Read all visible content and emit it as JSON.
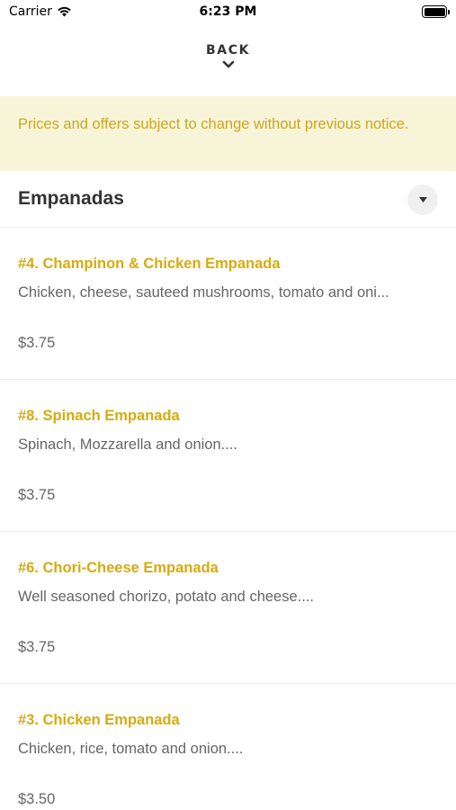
{
  "status_bar": {
    "carrier": "Carrier",
    "time": "6:23 PM",
    "wifi_icon": "wifi-icon",
    "battery_icon": "battery-icon"
  },
  "nav": {
    "back_label": "BACK",
    "back_icon": "chevron-down-icon"
  },
  "notice": {
    "text": "Prices and offers subject to change without previous notice.",
    "background_color": "#f8f4d8",
    "text_color": "#c9a820"
  },
  "section": {
    "title": "Empanadas",
    "toggle_icon": "caret-down-icon"
  },
  "items": [
    {
      "name": "#4. Champinon & Chicken Empanada",
      "description": "Chicken, cheese, sauteed mushrooms, tomato and oni...",
      "price": "$3.75"
    },
    {
      "name": "#8. Spinach Empanada",
      "description": "Spinach, Mozzarella and onion....",
      "price": "$3.75"
    },
    {
      "name": "#6. Chori-Cheese Empanada",
      "description": "Well seasoned chorizo, potato and cheese....",
      "price": "$3.75"
    },
    {
      "name": "#3. Chicken Empanada",
      "description": "Chicken, rice, tomato and onion....",
      "price": "$3.50"
    }
  ],
  "colors": {
    "accent": "#d6ab0f",
    "body_text": "#666666"
  }
}
